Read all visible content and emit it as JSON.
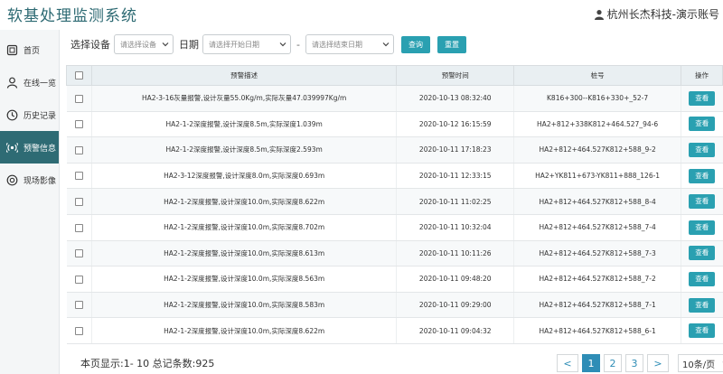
{
  "header": {
    "title": "软基处理监测系统",
    "user": "杭州长杰科技-演示账号"
  },
  "sidebar": {
    "items": [
      {
        "label": "首页",
        "icon": "home-icon",
        "active": false
      },
      {
        "label": "在线一览",
        "icon": "user-icon",
        "active": false
      },
      {
        "label": "历史记录",
        "icon": "clock-icon",
        "active": false
      },
      {
        "label": "预警信息",
        "icon": "alert-icon",
        "active": true
      },
      {
        "label": "现场影像",
        "icon": "camera-icon",
        "active": false
      }
    ]
  },
  "filter": {
    "device_label": "选择设备",
    "device_placeholder": "请选择设备",
    "date_label": "日期",
    "start_placeholder": "请选择开始日期",
    "separator": "-",
    "end_placeholder": "请选择结束日期",
    "query_label": "查询",
    "reset_label": "重置"
  },
  "table": {
    "columns": [
      "",
      "预警描述",
      "预警时间",
      "桩号",
      "操作"
    ],
    "action_label": "查看",
    "rows": [
      {
        "desc": "HA2-3-16灰量报警,设计灰量55.0Kg/m,实际灰量47.039997Kg/m",
        "time": "2020-10-13 08:32:40",
        "pile": "K816+300--K816+330+_52-7"
      },
      {
        "desc": "HA2-1-2深度报警,设计深度8.5m,实际深度1.039m",
        "time": "2020-10-12 16:15:59",
        "pile": "HA2+812+338K812+464.527_94-6"
      },
      {
        "desc": "HA2-1-2深度报警,设计深度8.5m,实际深度2.593m",
        "time": "2020-10-11 17:18:23",
        "pile": "HA2+812+464.527K812+588_9-2"
      },
      {
        "desc": "HA2-3-12深度报警,设计深度8.0m,实际深度0.693m",
        "time": "2020-10-11 12:33:15",
        "pile": "HA2+YK811+673-YK811+888_126-1"
      },
      {
        "desc": "HA2-1-2深度报警,设计深度10.0m,实际深度8.622m",
        "time": "2020-10-11 11:02:25",
        "pile": "HA2+812+464.527K812+588_8-4"
      },
      {
        "desc": "HA2-1-2深度报警,设计深度10.0m,实际深度8.702m",
        "time": "2020-10-11 10:32:04",
        "pile": "HA2+812+464.527K812+588_7-4"
      },
      {
        "desc": "HA2-1-2深度报警,设计深度10.0m,实际深度8.613m",
        "time": "2020-10-11 10:11:26",
        "pile": "HA2+812+464.527K812+588_7-3"
      },
      {
        "desc": "HA2-1-2深度报警,设计深度10.0m,实际深度8.563m",
        "time": "2020-10-11 09:48:20",
        "pile": "HA2+812+464.527K812+588_7-2"
      },
      {
        "desc": "HA2-1-2深度报警,设计深度10.0m,实际深度8.583m",
        "time": "2020-10-11 09:29:00",
        "pile": "HA2+812+464.527K812+588_7-1"
      },
      {
        "desc": "HA2-1-2深度报警,设计深度10.0m,实际深度8.622m",
        "time": "2020-10-11 09:04:32",
        "pile": "HA2+812+464.527K812+588_6-1"
      }
    ]
  },
  "footer": {
    "summary": "本页显示:1- 10 总记条数:925",
    "prev": "<",
    "next": ">",
    "pages": [
      "1",
      "2",
      "3"
    ],
    "current_page": "1",
    "page_size": "10条/页"
  },
  "colors": {
    "accent": "#2aa0b1",
    "sidebar_active": "#2e6b74",
    "pager": "#2e8db6"
  }
}
